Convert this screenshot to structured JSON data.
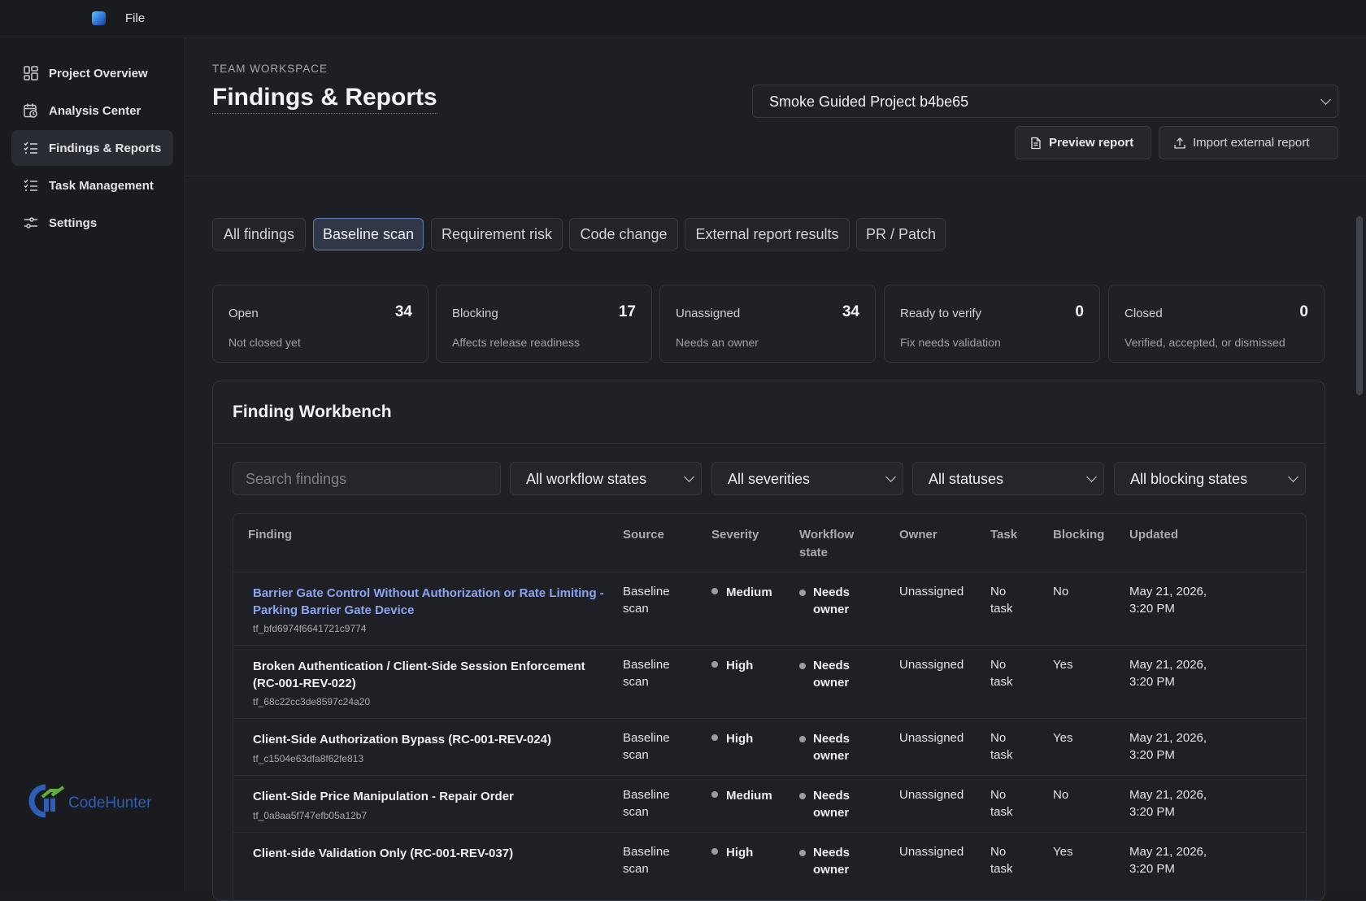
{
  "menu": {
    "file": "File"
  },
  "sidebar": {
    "items": [
      {
        "label": "Project Overview",
        "icon": "dashboard-icon"
      },
      {
        "label": "Analysis Center",
        "icon": "calendar-clock-icon"
      },
      {
        "label": "Findings & Reports",
        "icon": "checklist-icon",
        "active": true
      },
      {
        "label": "Task Management",
        "icon": "checklist-icon"
      },
      {
        "label": "Settings",
        "icon": "sliders-icon"
      }
    ],
    "brand": "CodeHunter"
  },
  "header": {
    "eyebrow": "TEAM WORKSPACE",
    "title": "Findings & Reports",
    "project": "Smoke Guided Project b4be65",
    "preview_btn": "Preview report",
    "import_btn": "Import external report"
  },
  "tabs": [
    "All findings",
    "Baseline scan",
    "Requirement risk",
    "Code change",
    "External report results",
    "PR / Patch"
  ],
  "active_tab": "Baseline scan",
  "stats": [
    {
      "label": "Open",
      "value": "34",
      "sub": "Not closed yet"
    },
    {
      "label": "Blocking",
      "value": "17",
      "sub": "Affects release readiness"
    },
    {
      "label": "Unassigned",
      "value": "34",
      "sub": "Needs an owner"
    },
    {
      "label": "Ready to verify",
      "value": "0",
      "sub": "Fix needs validation"
    },
    {
      "label": "Closed",
      "value": "0",
      "sub": "Verified, accepted, or dismissed"
    }
  ],
  "workbench": {
    "title": "Finding Workbench",
    "search_placeholder": "Search findings",
    "filters": [
      "All workflow states",
      "All severities",
      "All statuses",
      "All blocking states"
    ],
    "columns": [
      "Finding",
      "Source",
      "Severity",
      "Workflow state",
      "Owner",
      "Task",
      "Blocking",
      "Updated"
    ],
    "rows": [
      {
        "title": "Barrier Gate Control Without Authorization or Rate Limiting - Parking Barrier Gate Device",
        "id": "tf_bfd6974f6641721c9774",
        "link": true,
        "source": "Baseline scan",
        "severity": "Medium",
        "workflow": "Needs owner",
        "owner": "Unassigned",
        "task": "No task",
        "blocking": "No",
        "updated": "May 21, 2026, 3:20 PM"
      },
      {
        "title": "Broken Authentication / Client-Side Session Enforcement (RC-001-REV-022)",
        "id": "tf_68c22cc3de8597c24a20",
        "link": false,
        "source": "Baseline scan",
        "severity": "High",
        "workflow": "Needs owner",
        "owner": "Unassigned",
        "task": "No task",
        "blocking": "Yes",
        "updated": "May 21, 2026, 3:20 PM"
      },
      {
        "title": "Client-Side Authorization Bypass (RC-001-REV-024)",
        "id": "tf_c1504e63dfa8f62fe813",
        "link": false,
        "source": "Baseline scan",
        "severity": "High",
        "workflow": "Needs owner",
        "owner": "Unassigned",
        "task": "No task",
        "blocking": "Yes",
        "updated": "May 21, 2026, 3:20 PM"
      },
      {
        "title": "Client-Side Price Manipulation - Repair Order",
        "id": "tf_0a8aa5f747efb05a12b7",
        "link": false,
        "source": "Baseline scan",
        "severity": "Medium",
        "workflow": "Needs owner",
        "owner": "Unassigned",
        "task": "No task",
        "blocking": "No",
        "updated": "May 21, 2026, 3:20 PM"
      },
      {
        "title": "Client-side Validation Only (RC-001-REV-037)",
        "id": "",
        "link": false,
        "source": "Baseline scan",
        "severity": "High",
        "workflow": "Needs owner",
        "owner": "Unassigned",
        "task": "No task",
        "blocking": "Yes",
        "updated": "May 21, 2026, 3:20 PM"
      }
    ]
  }
}
